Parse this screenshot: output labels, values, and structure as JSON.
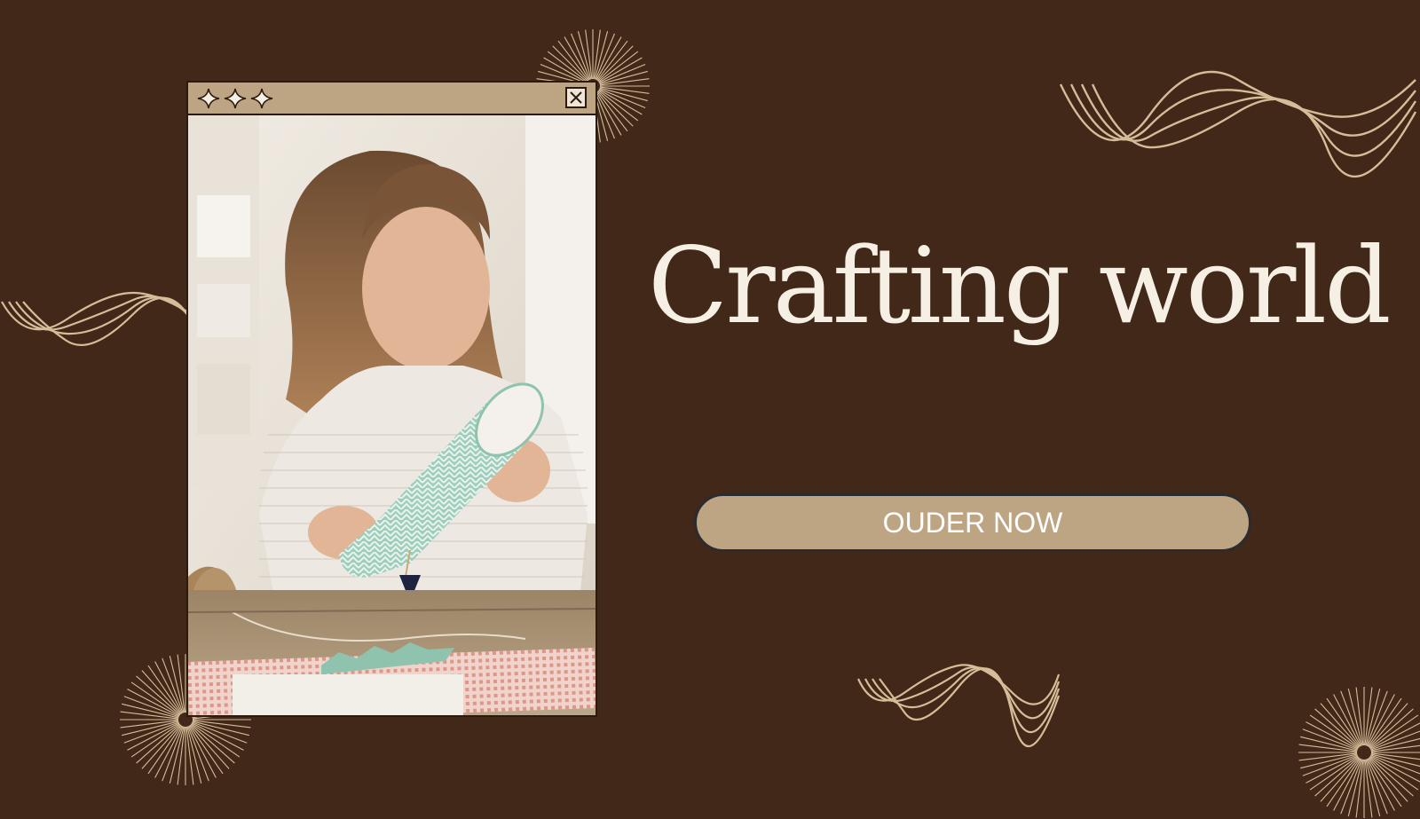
{
  "hero": {
    "title": "Crafting world",
    "cta_label": "OUDER NOW"
  },
  "window": {
    "title_icons": [
      "sparkle-icon",
      "sparkle-icon",
      "sparkle-icon"
    ],
    "close_icon": "close-icon"
  },
  "colors": {
    "background": "#412818",
    "accent": "#bda482",
    "line": "#d5bd9a",
    "text": "#f6efe4",
    "button_text": "#ffffff"
  }
}
